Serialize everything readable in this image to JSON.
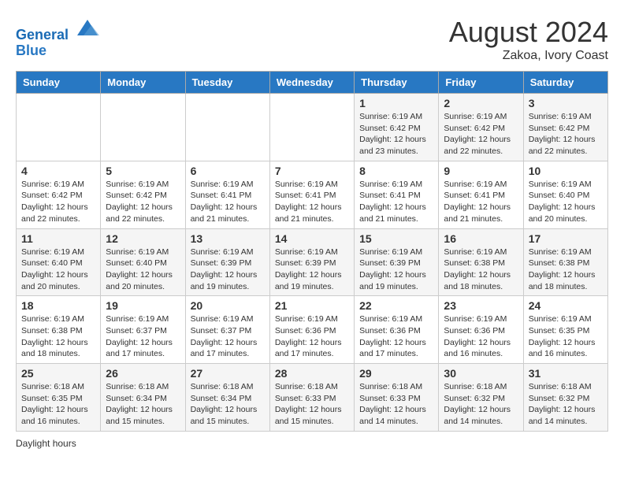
{
  "header": {
    "logo_line1": "General",
    "logo_line2": "Blue",
    "month_year": "August 2024",
    "location": "Zakoa, Ivory Coast"
  },
  "days_of_week": [
    "Sunday",
    "Monday",
    "Tuesday",
    "Wednesday",
    "Thursday",
    "Friday",
    "Saturday"
  ],
  "weeks": [
    [
      {
        "day": "",
        "detail": ""
      },
      {
        "day": "",
        "detail": ""
      },
      {
        "day": "",
        "detail": ""
      },
      {
        "day": "",
        "detail": ""
      },
      {
        "day": "1",
        "detail": "Sunrise: 6:19 AM\nSunset: 6:42 PM\nDaylight: 12 hours and 23 minutes."
      },
      {
        "day": "2",
        "detail": "Sunrise: 6:19 AM\nSunset: 6:42 PM\nDaylight: 12 hours and 22 minutes."
      },
      {
        "day": "3",
        "detail": "Sunrise: 6:19 AM\nSunset: 6:42 PM\nDaylight: 12 hours and 22 minutes."
      }
    ],
    [
      {
        "day": "4",
        "detail": "Sunrise: 6:19 AM\nSunset: 6:42 PM\nDaylight: 12 hours and 22 minutes."
      },
      {
        "day": "5",
        "detail": "Sunrise: 6:19 AM\nSunset: 6:42 PM\nDaylight: 12 hours and 22 minutes."
      },
      {
        "day": "6",
        "detail": "Sunrise: 6:19 AM\nSunset: 6:41 PM\nDaylight: 12 hours and 21 minutes."
      },
      {
        "day": "7",
        "detail": "Sunrise: 6:19 AM\nSunset: 6:41 PM\nDaylight: 12 hours and 21 minutes."
      },
      {
        "day": "8",
        "detail": "Sunrise: 6:19 AM\nSunset: 6:41 PM\nDaylight: 12 hours and 21 minutes."
      },
      {
        "day": "9",
        "detail": "Sunrise: 6:19 AM\nSunset: 6:41 PM\nDaylight: 12 hours and 21 minutes."
      },
      {
        "day": "10",
        "detail": "Sunrise: 6:19 AM\nSunset: 6:40 PM\nDaylight: 12 hours and 20 minutes."
      }
    ],
    [
      {
        "day": "11",
        "detail": "Sunrise: 6:19 AM\nSunset: 6:40 PM\nDaylight: 12 hours and 20 minutes."
      },
      {
        "day": "12",
        "detail": "Sunrise: 6:19 AM\nSunset: 6:40 PM\nDaylight: 12 hours and 20 minutes."
      },
      {
        "day": "13",
        "detail": "Sunrise: 6:19 AM\nSunset: 6:39 PM\nDaylight: 12 hours and 19 minutes."
      },
      {
        "day": "14",
        "detail": "Sunrise: 6:19 AM\nSunset: 6:39 PM\nDaylight: 12 hours and 19 minutes."
      },
      {
        "day": "15",
        "detail": "Sunrise: 6:19 AM\nSunset: 6:39 PM\nDaylight: 12 hours and 19 minutes."
      },
      {
        "day": "16",
        "detail": "Sunrise: 6:19 AM\nSunset: 6:38 PM\nDaylight: 12 hours and 18 minutes."
      },
      {
        "day": "17",
        "detail": "Sunrise: 6:19 AM\nSunset: 6:38 PM\nDaylight: 12 hours and 18 minutes."
      }
    ],
    [
      {
        "day": "18",
        "detail": "Sunrise: 6:19 AM\nSunset: 6:38 PM\nDaylight: 12 hours and 18 minutes."
      },
      {
        "day": "19",
        "detail": "Sunrise: 6:19 AM\nSunset: 6:37 PM\nDaylight: 12 hours and 17 minutes."
      },
      {
        "day": "20",
        "detail": "Sunrise: 6:19 AM\nSunset: 6:37 PM\nDaylight: 12 hours and 17 minutes."
      },
      {
        "day": "21",
        "detail": "Sunrise: 6:19 AM\nSunset: 6:36 PM\nDaylight: 12 hours and 17 minutes."
      },
      {
        "day": "22",
        "detail": "Sunrise: 6:19 AM\nSunset: 6:36 PM\nDaylight: 12 hours and 17 minutes."
      },
      {
        "day": "23",
        "detail": "Sunrise: 6:19 AM\nSunset: 6:36 PM\nDaylight: 12 hours and 16 minutes."
      },
      {
        "day": "24",
        "detail": "Sunrise: 6:19 AM\nSunset: 6:35 PM\nDaylight: 12 hours and 16 minutes."
      }
    ],
    [
      {
        "day": "25",
        "detail": "Sunrise: 6:18 AM\nSunset: 6:35 PM\nDaylight: 12 hours and 16 minutes."
      },
      {
        "day": "26",
        "detail": "Sunrise: 6:18 AM\nSunset: 6:34 PM\nDaylight: 12 hours and 15 minutes."
      },
      {
        "day": "27",
        "detail": "Sunrise: 6:18 AM\nSunset: 6:34 PM\nDaylight: 12 hours and 15 minutes."
      },
      {
        "day": "28",
        "detail": "Sunrise: 6:18 AM\nSunset: 6:33 PM\nDaylight: 12 hours and 15 minutes."
      },
      {
        "day": "29",
        "detail": "Sunrise: 6:18 AM\nSunset: 6:33 PM\nDaylight: 12 hours and 14 minutes."
      },
      {
        "day": "30",
        "detail": "Sunrise: 6:18 AM\nSunset: 6:32 PM\nDaylight: 12 hours and 14 minutes."
      },
      {
        "day": "31",
        "detail": "Sunrise: 6:18 AM\nSunset: 6:32 PM\nDaylight: 12 hours and 14 minutes."
      }
    ]
  ],
  "footer": {
    "daylight_label": "Daylight hours"
  }
}
